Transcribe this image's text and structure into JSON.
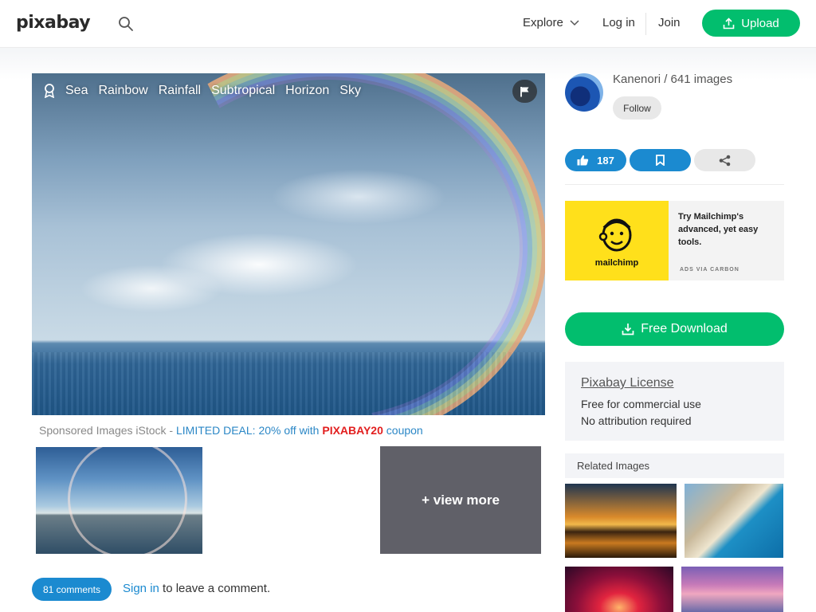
{
  "header": {
    "logo": "pixabay",
    "explore_label": "Explore",
    "login_label": "Log in",
    "join_label": "Join",
    "upload_label": "Upload"
  },
  "image": {
    "tags": [
      "Sea",
      "Rainbow",
      "Rainfall",
      "Subtropical",
      "Horizon",
      "Sky"
    ]
  },
  "sponsored": {
    "prefix": "Sponsored Images iStock - ",
    "deal": "LIMITED DEAL: 20% off with ",
    "code": "PIXABAY20",
    "suffix": " coupon",
    "view_more": "+ view more"
  },
  "comments": {
    "count_label": "81 comments",
    "signin_link": "Sign in",
    "signin_rest": " to leave a comment."
  },
  "author": {
    "name_line": "Kanenori / 641 images",
    "follow_label": "Follow"
  },
  "actions": {
    "likes": "187"
  },
  "ad": {
    "brand": "mailchimp",
    "text": "Try Mailchimp's advanced, yet easy tools.",
    "via": "ADS VIA CARBON"
  },
  "download": {
    "label": "Free Download"
  },
  "license": {
    "title": "Pixabay License",
    "line1": "Free for commercial use",
    "line2": "No attribution required"
  },
  "related": {
    "title": "Related Images"
  },
  "colors": {
    "green": "#02be6e",
    "blue": "#1b8ad0",
    "promo_red": "#e21f1f"
  }
}
